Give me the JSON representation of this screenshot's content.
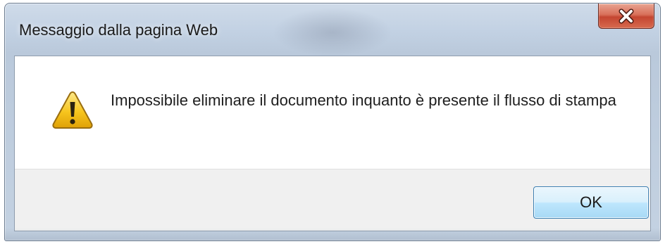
{
  "window": {
    "title": "Messaggio dalla pagina Web"
  },
  "titlebar_controls": {
    "close_icon": "close-icon"
  },
  "dialog": {
    "icon": "warning-icon",
    "message": "Impossibile eliminare il documento inquanto è presente il flusso di stampa"
  },
  "buttons": {
    "ok_label": "OK"
  },
  "colors": {
    "frame": "#c2d1e3",
    "close_button": "#c44631",
    "ok_button": "#bee6fd",
    "warning_fill": "#f7c51e"
  }
}
